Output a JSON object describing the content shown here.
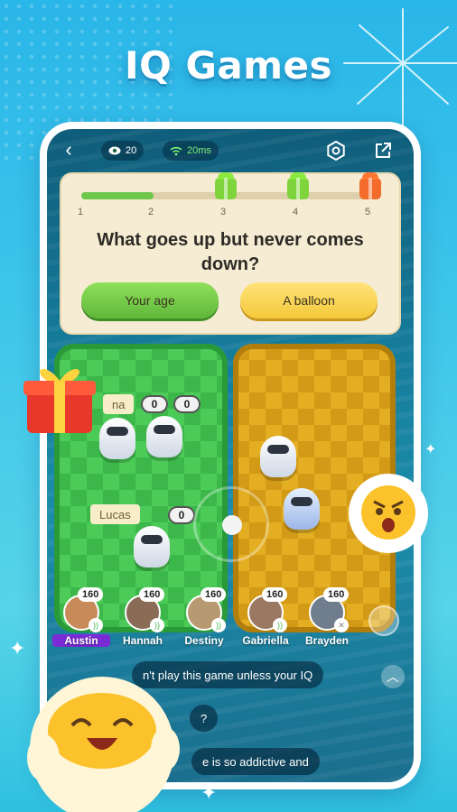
{
  "headline": "IQ Games",
  "topbar": {
    "back_icon": "chevron-left-icon",
    "viewers": "20",
    "ping": "20ms",
    "settings_icon": "gear-icon",
    "share_icon": "share-icon"
  },
  "quiz": {
    "progress": 0.25,
    "steps": [
      "1",
      "2",
      "3",
      "4",
      "5"
    ],
    "question": "What goes up but never comes down?",
    "answers": [
      "Your age",
      "A balloon"
    ]
  },
  "board": {
    "tag_1": "na",
    "score_1a": "0",
    "score_1b": "0",
    "tag_2": "Lucas",
    "score_2": "0"
  },
  "players": [
    {
      "name": "Austin",
      "score": "160",
      "host": true
    },
    {
      "name": "Hannah",
      "score": "160"
    },
    {
      "name": "Destiny",
      "score": "160"
    },
    {
      "name": "Gabriella",
      "score": "160"
    },
    {
      "name": "Brayden",
      "score": "160",
      "muted": true
    }
  ],
  "chat": [
    "n't play this game unless your IQ",
    "?",
    "e is so addictive and"
  ],
  "colors": {
    "accent_green": "#5fb83a",
    "accent_yellow": "#f4c93a",
    "host_purple": "#7a2bd6"
  }
}
